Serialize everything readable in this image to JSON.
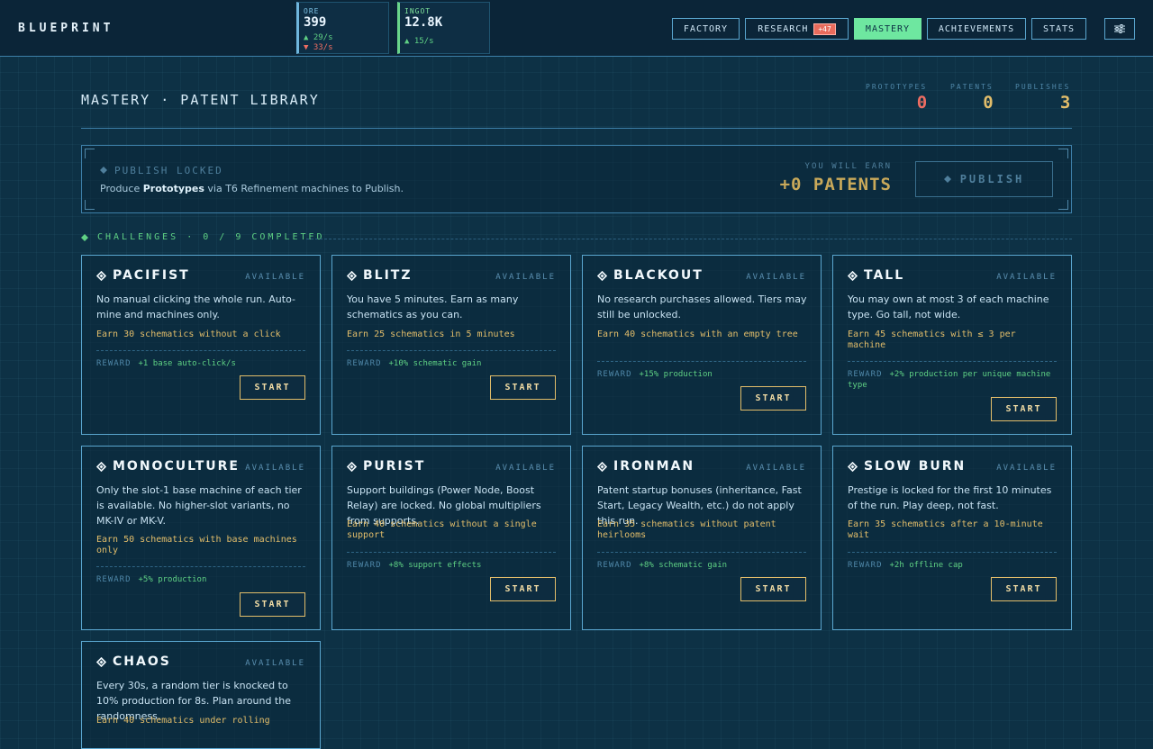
{
  "app": {
    "brand": "BLUEPRINT"
  },
  "resources": [
    {
      "name": "ORE",
      "value": "399",
      "up": "▲ 29/s",
      "down": "▼ 33/s"
    },
    {
      "name": "INGOT",
      "value": "12.8K",
      "up": "▲ 15/s"
    }
  ],
  "nav": [
    {
      "label": "FACTORY"
    },
    {
      "label": "RESEARCH",
      "badge": "+47"
    },
    {
      "label": "MASTERY",
      "active": true
    },
    {
      "label": "ACHIEVEMENTS"
    },
    {
      "label": "STATS"
    }
  ],
  "header": {
    "title": "MASTERY · PATENT LIBRARY",
    "stats": [
      {
        "label": "PROTOTYPES",
        "value": "0",
        "color": "#ee6d62"
      },
      {
        "label": "PATENTS",
        "value": "0",
        "color": "#e2bd6a"
      },
      {
        "label": "PUBLISHES",
        "value": "3",
        "color": "#e2bd6a"
      }
    ]
  },
  "publish": {
    "title": "PUBLISH LOCKED",
    "desc_pre": "Produce ",
    "desc_bold": "Prototypes",
    "desc_post": " via T6 Refinement machines to Publish.",
    "earn_label": "YOU WILL EARN",
    "earn_value": "+0 PATENTS",
    "button": "PUBLISH"
  },
  "challenges": {
    "heading": "CHALLENGES · 0 / 9 COMPLETED",
    "reward_label": "REWARD",
    "start_label": "START",
    "items": [
      {
        "name": "PACIFIST",
        "status": "AVAILABLE",
        "desc": "No manual clicking the whole run. Auto-mine and machines only.",
        "goal": "Earn 30 schematics without a click",
        "reward": "+1 base auto-click/s"
      },
      {
        "name": "BLITZ",
        "status": "AVAILABLE",
        "desc": "You have 5 minutes. Earn as many schematics as you can.",
        "goal": "Earn 25 schematics in 5 minutes",
        "reward": "+10% schematic gain"
      },
      {
        "name": "BLACKOUT",
        "status": "AVAILABLE",
        "desc": "No research purchases allowed. Tiers may still be unlocked.",
        "goal": "Earn 40 schematics with an empty tree",
        "reward": "+15% production"
      },
      {
        "name": "TALL",
        "status": "AVAILABLE",
        "desc": "You may own at most 3 of each machine type. Go tall, not wide.",
        "goal": "Earn 45 schematics with ≤ 3 per machine",
        "reward": "+2% production per unique machine type"
      },
      {
        "name": "MONOCULTURE",
        "status": "AVAILABLE",
        "desc": "Only the slot-1 base machine of each tier is available. No higher-slot variants, no MK-IV or MK-V.",
        "goal": "Earn 50 schematics with base machines only",
        "reward": "+5% production"
      },
      {
        "name": "PURIST",
        "status": "AVAILABLE",
        "desc": "Support buildings (Power Node, Boost Relay) are locked. No global multipliers from supports.",
        "goal": "Earn 40 schematics without a single support",
        "reward": "+8% support effects"
      },
      {
        "name": "IRONMAN",
        "status": "AVAILABLE",
        "desc": "Patent startup bonuses (inheritance, Fast Start, Legacy Wealth, etc.) do not apply this run.",
        "goal": "Earn 35 schematics without patent heirlooms",
        "reward": "+8% schematic gain"
      },
      {
        "name": "SLOW BURN",
        "status": "AVAILABLE",
        "desc": "Prestige is locked for the first 10 minutes of the run. Play deep, not fast.",
        "goal": "Earn 35 schematics after a 10-minute wait",
        "reward": "+2h offline cap"
      },
      {
        "name": "CHAOS",
        "status": "AVAILABLE",
        "desc": "Every 30s, a random tier is knocked to 10% production for 8s. Plan around the randomness.",
        "goal": "Earn 40 schematics under rolling"
      }
    ]
  }
}
